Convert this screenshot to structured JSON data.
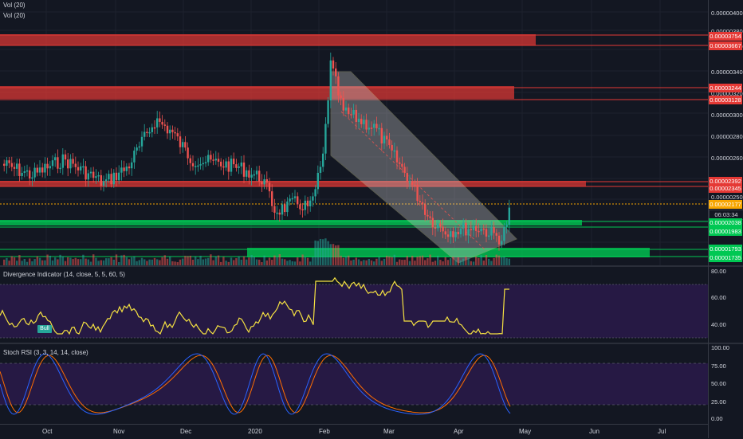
{
  "legend": {
    "vol1": "Vol (20)",
    "vol2": "Vol (20)",
    "divergence": "Divergence Indicator (14, close, 5, 5, 60, 5)",
    "stoch": "Stoch RSI (3, 3, 14, 14, close)"
  },
  "price_ticks": [
    "0.00000400",
    "0.00000380",
    "0.00000360",
    "0.00000340",
    "0.00000320",
    "0.00000300",
    "0.00000280",
    "0.00000260",
    "0.00000250",
    "0.00000220"
  ],
  "price_tags": [
    {
      "value": "0.00003754",
      "color": "#e53935"
    },
    {
      "value": "0.00003667",
      "color": "#e53935"
    },
    {
      "value": "0.00003244",
      "color": "#e53935"
    },
    {
      "value": "0.00003128",
      "color": "#e53935"
    },
    {
      "value": "0.00002392",
      "color": "#e53935"
    },
    {
      "value": "0.00002345",
      "color": "#e53935"
    },
    {
      "value": "0.00002177",
      "color": "#f7a600"
    },
    {
      "value": "06:03:34",
      "color": "#131722"
    },
    {
      "value": "0.00002038",
      "color": "#00c853"
    },
    {
      "value": "0.00001983",
      "color": "#00c853"
    },
    {
      "value": "0.00001793",
      "color": "#00c853"
    },
    {
      "value": "0.00001735",
      "color": "#00c853"
    }
  ],
  "div_ticks": [
    "80.00",
    "60.00",
    "40.00"
  ],
  "rsi_ticks": [
    "100.00",
    "75.00",
    "50.00",
    "25.00",
    "0.00"
  ],
  "bull_label": "Bull",
  "time_labels": [
    "Oct",
    "Nov",
    "Dec",
    "2020",
    "Feb",
    "Mar",
    "Apr",
    "May",
    "Jun",
    "Jul"
  ],
  "colors": {
    "up": "#26a69a",
    "down": "#ef5350",
    "resistance": "#e53935",
    "support": "#00c853",
    "divergence_line": "#f5e142",
    "stoch_k": "#2962ff",
    "stoch_d": "#ff6d00",
    "channel": "#c8c8c8"
  }
}
